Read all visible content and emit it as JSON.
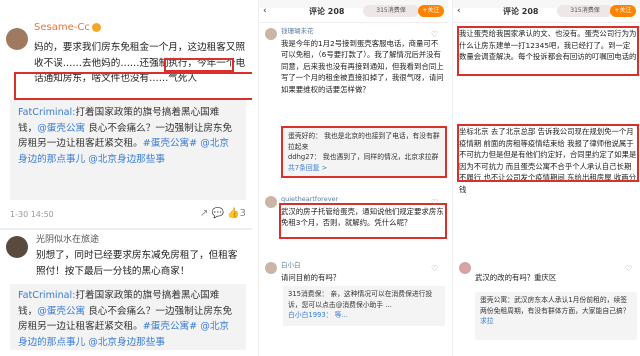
{
  "panel1": {
    "post": {
      "username": "Sesame-Cc",
      "text": "妈的，要求我们房东免租金一个月，这边租客又照收不误……去他妈的……还强制执行，今年一个电话通知房东，啥文件也没有……气死人",
      "repost_author": "FatCriminal:",
      "repost_text": "打着国家政策的旗号搞着黑心国难钱，",
      "repost_tag": "@蛋壳公寓",
      "repost_rest": " 良心不会痛么？一边强制让房东免房租另一边让租客赶紧交租。",
      "repost_tag2": "#蛋壳公寓#",
      "repost_link": "@北京身边的那点事儿",
      "repost_link2": "@北京身边那些事",
      "time": "1-30 14:50",
      "actions": "↗ 💬 👍3"
    },
    "post2": {
      "username": "光阴似水在旅途",
      "text": "别想了，同时已经要求房东减免房租了，但租客照付！按下最后一分钱的黑心商家！",
      "repost_author": "FatCriminal:",
      "repost_text": "打着国家政策的旗号搞着黑心国难钱，",
      "repost_tag": "@蛋壳公寓",
      "repost_rest": " 良心不会痛么？一边强制让房东免房租另一边让租客赶紧交租。",
      "repost_tag2": "#蛋壳公寓#",
      "repost_link": "@北京身边的那点事儿",
      "repost_link2": "@北京身边那些事"
    }
  },
  "panel2": {
    "header": {
      "title": "评论 208",
      "badge": "315消费保",
      "follow": "+关注"
    },
    "c1": {
      "name": "钱珊瑚未花",
      "text": "我是今年的1月2号接到蛋壳客服电话，商量可不可以免租，（6号要打款了）。我了解情况后并没有同意，后来我也没有再接到通知，但我看到合同上写了一个月的租金被直接扣掉了，我很气呀，请问如果要维权的话要怎样做？"
    },
    "c1_sub": {
      "text1": "蛋壳好的： 我也是北京的也接到了电话，有没有群拉起来",
      "text2": "ddhg27： 我也遇到了，同样的情况，北京求拉群",
      "more": "共7条回复 >"
    },
    "c2": {
      "name": "quietheartforever",
      "text": "武汉的房子托管给蛋壳，通知说他们规定要求房东免租3个月，否则，就解约。凭什么呢？"
    },
    "c3": {
      "name": "白小白",
      "text": "请问目前的有吗？"
    },
    "c3_sub": {
      "text": "315消费保： 亲，这种情况可以在消费保进行投诉，您可以点击@消费保小助手 ...",
      "more": "白小白1993： 等..."
    }
  },
  "panel3": {
    "header": {
      "title": "评论 208",
      "badge": "315消费保",
      "follow": "+关注"
    },
    "c1": {
      "text": "我让蛋壳给我国家承认的文、也没有。蛋壳公司行为为什么让房东建单一打12345吧，我已经打了。到一定数量会调查解决。每个投诉都会有回访的叮嘱回电话的"
    },
    "c2": {
      "text": "坐标北京 去了北京总部 告诉我公司现在规划免一个月疫情期 前面的房租等疫情结束给 我报了律师他说属于不可抗力但是但是有他们约定好，合同里约定了如果是因为不可抗力 而且蛋壳公寓不合乎个人承认自己长期不履行 也不让公司发个疫情期间 东给出租房屋 收两分钱"
    },
    "c3": {
      "text": "武汉的改的有吗？重庆区"
    },
    "c3_sub": {
      "text": "蛋壳公寓：武汉房东本人承认1月份前租的，续签两份免租周期，有没有群体方面，大家能自己搞？",
      "more": "求拉"
    }
  }
}
